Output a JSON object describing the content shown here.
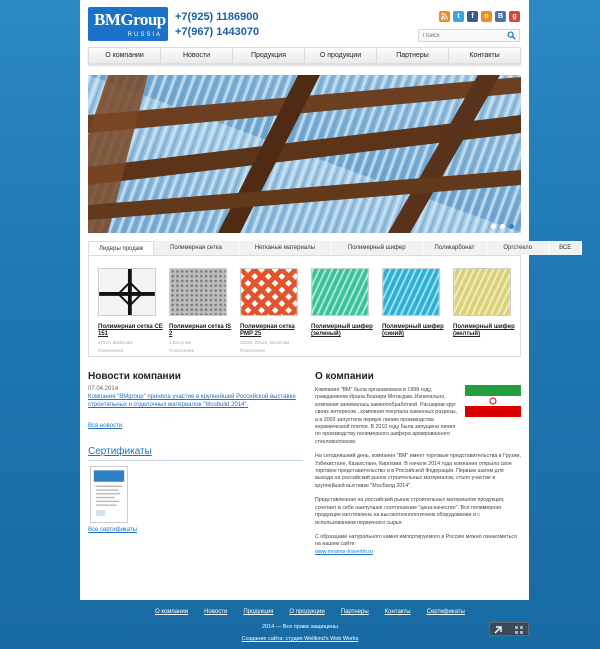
{
  "header": {
    "logo_main": "BMGroup",
    "logo_sub": "RUSSIA",
    "phones": [
      "+7(925) 1186900",
      "+7(967) 1443070"
    ],
    "socials": [
      {
        "name": "rss-icon",
        "glyph": "◉",
        "color": "#f48a24"
      },
      {
        "name": "twitter-icon",
        "glyph": "t",
        "color": "#3ca4e6"
      },
      {
        "name": "facebook-icon",
        "glyph": "f",
        "color": "#3b5998"
      },
      {
        "name": "odnoklassniki-icon",
        "glyph": "о",
        "color": "#f08b1d"
      },
      {
        "name": "vk-icon",
        "glyph": "В",
        "color": "#4c75a3"
      },
      {
        "name": "googleplus-icon",
        "glyph": "g",
        "color": "#d34836"
      }
    ],
    "search_placeholder": "Поиск"
  },
  "nav": [
    "О компании",
    "Новости",
    "Продукция",
    "О продукции",
    "Партнеры",
    "Контакты"
  ],
  "tabs": [
    "Лидеры продаж",
    "Полимерная сетка",
    "Нетканые материалы",
    "Полимерный шифер",
    "Поликарбонат",
    "Оргстекло",
    "ВСЕ"
  ],
  "products": [
    {
      "name": "Полимерная сетка CE 151",
      "spec": "27х27, 50х50 мм",
      "sub": "Полиэтилен",
      "color": "#222222"
    },
    {
      "name": "Полимерная сетка IS 2",
      "spec": "1,5х1,5 мм",
      "sub": "Полиэтилен",
      "color": "#9a9a9a"
    },
    {
      "name": "Полимерная сетка PMP 25",
      "spec": "20х25, 20х25, 40х48 мм",
      "sub": "Полиэтилен",
      "color": "#e0542e"
    },
    {
      "name": "Полимерный шифер (зеленый)",
      "spec": "",
      "sub": "",
      "color": "#3fbf9a"
    },
    {
      "name": "Полимерный шифер (синий)",
      "spec": "",
      "sub": "",
      "color": "#2fb0d0"
    },
    {
      "name": "Полимерный шифер (желтый)",
      "spec": "",
      "sub": "",
      "color": "#d8d07a"
    }
  ],
  "news": {
    "title": "Новости компании",
    "date": "07.04.2014",
    "item": "Компания \"BMgroup\" приняла участие в крупнейшей Российской выставке строительных и отделочных материалов \"Mosbuild 2014\".",
    "all": "Вся новости"
  },
  "certs": {
    "title": "Сертификаты",
    "all": "Все сертификаты"
  },
  "about": {
    "title": "О компании",
    "p1": "Компания \"ВМ\" была организована в 1998 году, гражданином Ирана Боззари Мотагдам. Изначально, компания занималась каменообработкой. Расширив круг своих интересов , компания покупала каменных разрезы, а в 2003 запустила первую линию производства керамической плитки. В 2010 году была запущена линия по производству полимерного шифера армированного стекловолокном.",
    "p2": "На сегодняшний день, компания \"ВМ\" имеет торговые представительства в Грузии, Узбекистане, Казахстане, Киргизии. В начале 2014 года компания открыла свое торговое представительство и в Российской Федерации. Первым шагом для выхода на российский рынок строительных материалов, стало участие в крупнейшей выставке \"МосБилд 2014\".",
    "p3": "Представленная на российский рынок строительных материалов продукция, сочетает в себе наилучшее соотношение \"цена-качество\". Вся полимерная продукция изготовлена на высокотехнологичном оборудовании и с использованием первичного сырья.",
    "p4": "С образцами натурального камня импортируемого в Россию можно ознакомиться на нашем сайте:",
    "link": "www.mramor-travertin.ru"
  },
  "footer": {
    "nav": [
      "О компании",
      "Новости",
      "Продукция",
      "О продукции",
      "Партнеры",
      "Контакты",
      "Сертификаты"
    ],
    "copyright": "2014 — Все права защищены",
    "credit": "Создание сайта: студия Wellkind's Web Works"
  },
  "colors": {
    "accent": "#1a73c9",
    "background": "#1f79b4"
  }
}
